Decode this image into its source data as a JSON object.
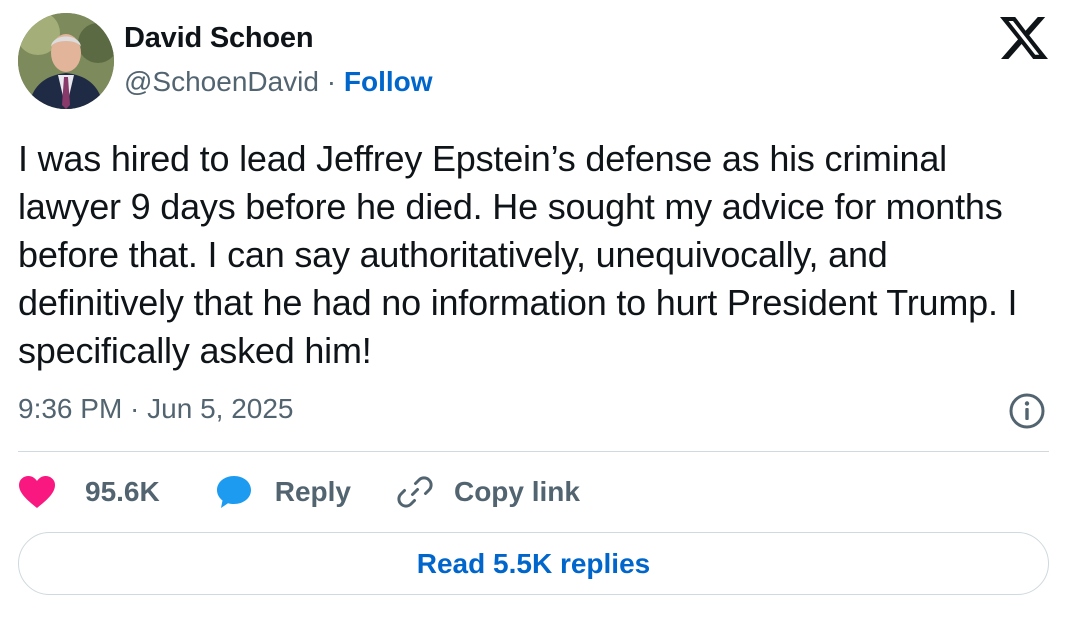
{
  "author": {
    "display_name": "David Schoen",
    "handle": "@SchoenDavid",
    "separator": "·",
    "follow_label": "Follow"
  },
  "tweet": {
    "text": "I was hired to lead Jeffrey Epstein’s defense as his criminal lawyer 9 days before he died.  He sought my advice for months before that.  I can say authoritatively, unequivocally, and definitively that he had no information to hurt President Trump.  I specifically asked him!",
    "timestamp": "9:36 PM · Jun 5, 2025"
  },
  "actions": {
    "like_count": "95.6K",
    "reply_label": "Reply",
    "copy_link_label": "Copy link"
  },
  "read_replies_label": "Read 5.5K replies",
  "icons": {
    "logo": "x-logo-icon",
    "info": "info-icon",
    "like": "heart-icon",
    "reply": "speech-bubble-icon",
    "copy": "link-icon"
  },
  "colors": {
    "text": "#0f1419",
    "secondary": "#536471",
    "link_blue": "#0066cc",
    "heart_pink": "#f91880",
    "reply_blue": "#1d9bf0",
    "border": "#cfd9de"
  }
}
